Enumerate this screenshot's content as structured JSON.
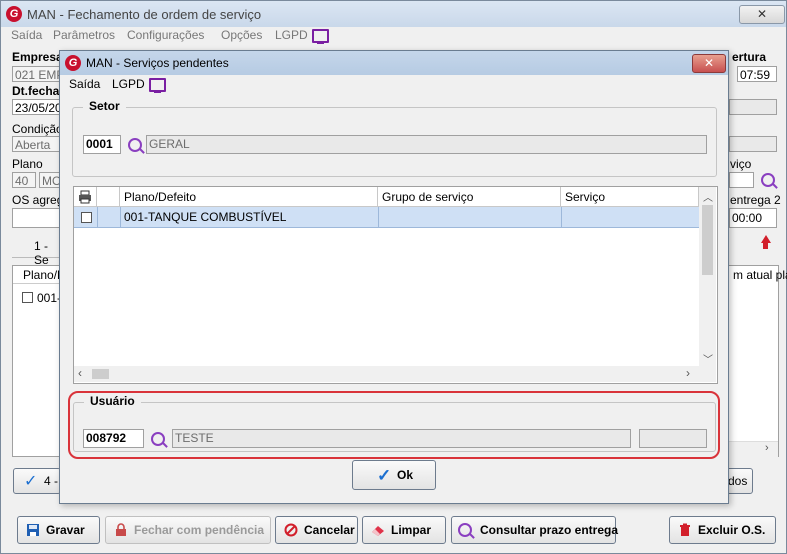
{
  "main": {
    "title": "MAN - Fechamento de ordem de serviço",
    "close": "✕",
    "menu": [
      "Saída",
      "Parâmetros",
      "Configurações",
      "Opções",
      "LGPD"
    ],
    "empresa_label": "Empresa",
    "empresa_value": "021 EMP",
    "abertura_label": "ertura",
    "abertura_time": "07:59",
    "dtfecha_label": "Dt.fecha",
    "dtfecha_value": "23/05/20",
    "condicao_label": "Condição",
    "condicao_value": "Aberta",
    "plano_label": "Plano",
    "plano_code": "40",
    "plano_value": "MO",
    "servico_label": "viço",
    "os_agrega_label": "OS agrega",
    "entrega_label": "entrega 2",
    "entrega_value": "00:00",
    "tab1_label": "1 - Se",
    "grid_col1": "Plano/D",
    "grid_row1": "001-",
    "grid_col_right": "m atual pla",
    "btn4_label": "4 -",
    "btn_right_label": "dos",
    "btn_gravar": "Gravar",
    "btn_fechar": "Fechar com pendência",
    "btn_cancelar": "Cancelar",
    "btn_limpar": "Limpar",
    "btn_consultar": "Consultar prazo entrega",
    "btn_excluir": "Excluir O.S."
  },
  "modal": {
    "title": "MAN - Serviços pendentes",
    "close": "✕",
    "menu": [
      "Saída",
      "LGPD"
    ],
    "setor_title": "Setor",
    "setor_code": "0001",
    "setor_name": "GERAL",
    "columns": [
      "Plano/Defeito",
      "Grupo de serviço",
      "Serviço"
    ],
    "rows": [
      {
        "plano": "001-TANQUE COMBUSTÍVEL",
        "grupo": "",
        "servico": ""
      }
    ],
    "usuario_title": "Usuário",
    "usuario_code": "008792",
    "usuario_name": "TESTE",
    "ok_label": "Ok"
  },
  "colors": {
    "accent_red": "#d21f2b",
    "selected_row": "#cfe0f5",
    "lgpd_purple": "#7a1fa2"
  }
}
